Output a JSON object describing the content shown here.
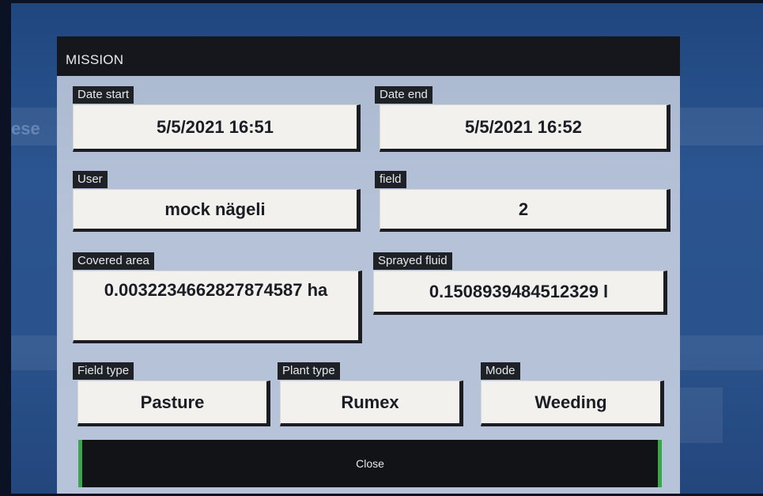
{
  "dialog": {
    "title": "MISSION",
    "date_start": {
      "label": "Date start",
      "value": "5/5/2021 16:51"
    },
    "date_end": {
      "label": "Date end",
      "value": "5/5/2021 16:52"
    },
    "user": {
      "label": "User",
      "value": "mock nägeli"
    },
    "field": {
      "label": "field",
      "value": "2"
    },
    "covered_area": {
      "label": "Covered area",
      "value": "0.0032234662827874587 ha"
    },
    "sprayed_fluid": {
      "label": "Sprayed fluid",
      "value": "0.1508939484512329 l"
    },
    "field_type": {
      "label": "Field type",
      "value": "Pasture"
    },
    "plant_type": {
      "label": "Plant type",
      "value": "Rumex"
    },
    "mode": {
      "label": "Mode",
      "value": "Weeding"
    },
    "close_label": "Close"
  },
  "colors": {
    "header_bg": "#15171c",
    "dialog_bg": "#b5c2d8",
    "accent_green": "#3aa54a",
    "screen_bg": "#2b5590"
  }
}
